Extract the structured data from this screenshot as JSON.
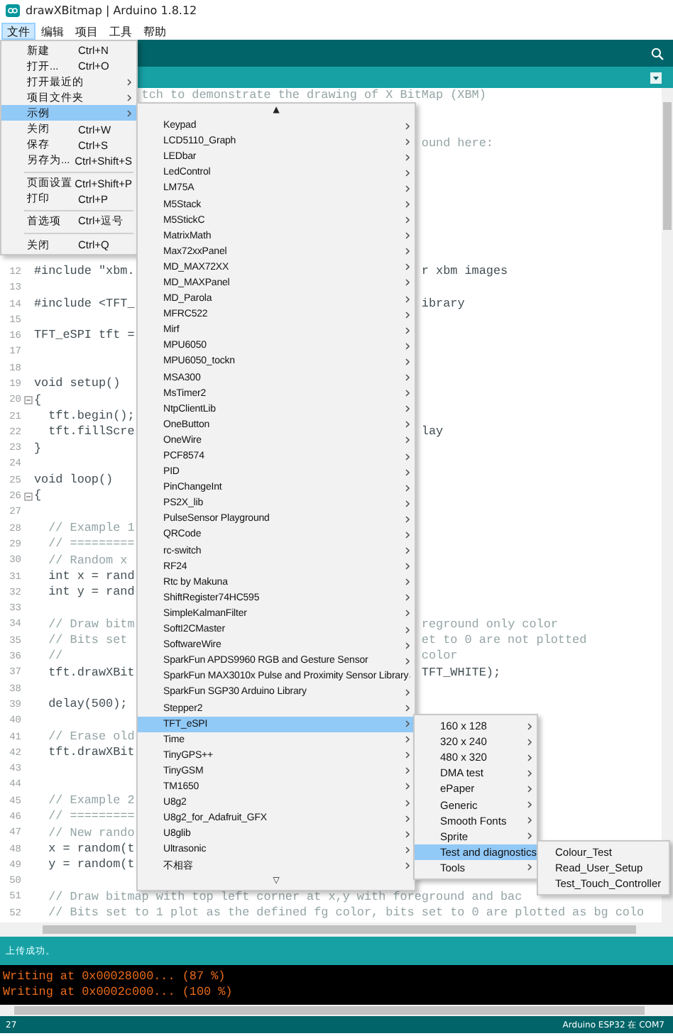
{
  "window": {
    "title": "drawXBitmap | Arduino 1.8.12"
  },
  "menubar": [
    {
      "label": "文件",
      "selected": true
    },
    {
      "label": "编辑",
      "selected": false
    },
    {
      "label": "项目",
      "selected": false
    },
    {
      "label": "工具",
      "selected": false
    },
    {
      "label": "帮助",
      "selected": false
    }
  ],
  "file_menu": [
    {
      "kind": "item",
      "label": "新建",
      "shortcut": "Ctrl+N",
      "submenu": false,
      "selected": false
    },
    {
      "kind": "item",
      "label": "打开...",
      "shortcut": "Ctrl+O",
      "submenu": false,
      "selected": false
    },
    {
      "kind": "item",
      "label": "打开最近的",
      "submenu": true,
      "selected": false
    },
    {
      "kind": "item",
      "label": "项目文件夹",
      "submenu": true,
      "selected": false
    },
    {
      "kind": "item",
      "label": "示例",
      "submenu": true,
      "selected": true
    },
    {
      "kind": "item",
      "label": "关闭",
      "shortcut": "Ctrl+W",
      "submenu": false,
      "selected": false
    },
    {
      "kind": "item",
      "label": "保存",
      "shortcut": "Ctrl+S",
      "submenu": false,
      "selected": false
    },
    {
      "kind": "item",
      "label": "另存为...",
      "shortcut": "Ctrl+Shift+S",
      "submenu": false,
      "selected": false
    },
    {
      "kind": "separator"
    },
    {
      "kind": "item",
      "label": "页面设置",
      "shortcut": "Ctrl+Shift+P",
      "submenu": false,
      "selected": false
    },
    {
      "kind": "item",
      "label": "打印",
      "shortcut": "Ctrl+P",
      "submenu": false,
      "selected": false
    },
    {
      "kind": "separator"
    },
    {
      "kind": "item",
      "label": "首选项",
      "shortcut": "Ctrl+逗号",
      "submenu": false,
      "selected": false
    },
    {
      "kind": "separator"
    },
    {
      "kind": "item",
      "label": "关闭",
      "shortcut": "Ctrl+Q",
      "submenu": false,
      "selected": false
    }
  ],
  "examples_menu": {
    "scroll_up": "▲",
    "scroll_down": "▽",
    "items": [
      {
        "label": "Keypad",
        "selected": false
      },
      {
        "label": "LCD5110_Graph",
        "selected": false
      },
      {
        "label": "LEDbar",
        "selected": false
      },
      {
        "label": "LedControl",
        "selected": false
      },
      {
        "label": "LM75A",
        "selected": false
      },
      {
        "label": "M5Stack",
        "selected": false
      },
      {
        "label": "M5StickC",
        "selected": false
      },
      {
        "label": "MatrixMath",
        "selected": false
      },
      {
        "label": "Max72xxPanel",
        "selected": false
      },
      {
        "label": "MD_MAX72XX",
        "selected": false
      },
      {
        "label": "MD_MAXPanel",
        "selected": false
      },
      {
        "label": "MD_Parola",
        "selected": false
      },
      {
        "label": "MFRC522",
        "selected": false
      },
      {
        "label": "Mirf",
        "selected": false
      },
      {
        "label": "MPU6050",
        "selected": false
      },
      {
        "label": "MPU6050_tockn",
        "selected": false
      },
      {
        "label": "MSA300",
        "selected": false
      },
      {
        "label": "MsTimer2",
        "selected": false
      },
      {
        "label": "NtpClientLib",
        "selected": false
      },
      {
        "label": "OneButton",
        "selected": false
      },
      {
        "label": "OneWire",
        "selected": false
      },
      {
        "label": "PCF8574",
        "selected": false
      },
      {
        "label": "PID",
        "selected": false
      },
      {
        "label": "PinChangeInt",
        "selected": false
      },
      {
        "label": "PS2X_lib",
        "selected": false
      },
      {
        "label": "PulseSensor Playground",
        "selected": false
      },
      {
        "label": "QRCode",
        "selected": false
      },
      {
        "label": "rc-switch",
        "selected": false
      },
      {
        "label": "RF24",
        "selected": false
      },
      {
        "label": "Rtc by Makuna",
        "selected": false
      },
      {
        "label": "ShiftRegister74HC595",
        "selected": false
      },
      {
        "label": "SimpleKalmanFilter",
        "selected": false
      },
      {
        "label": "SoftI2CMaster",
        "selected": false
      },
      {
        "label": "SoftwareWire",
        "selected": false
      },
      {
        "label": "SparkFun APDS9960 RGB and Gesture Sensor",
        "selected": false
      },
      {
        "label": "SparkFun MAX3010x Pulse and Proximity Sensor Library",
        "selected": false
      },
      {
        "label": "SparkFun SGP30 Arduino Library",
        "selected": false
      },
      {
        "label": "Stepper2",
        "selected": false
      },
      {
        "label": "TFT_eSPI",
        "selected": true
      },
      {
        "label": "Time",
        "selected": false
      },
      {
        "label": "TinyGPS++",
        "selected": false
      },
      {
        "label": "TinyGSM",
        "selected": false
      },
      {
        "label": "TM1650",
        "selected": false
      },
      {
        "label": "U8g2",
        "selected": false
      },
      {
        "label": "U8g2_for_Adafruit_GFX",
        "selected": false
      },
      {
        "label": "U8glib",
        "selected": false
      },
      {
        "label": "Ultrasonic",
        "selected": false
      },
      {
        "label": "不相容",
        "selected": false
      }
    ]
  },
  "tft_menu": [
    {
      "label": "160 x 128",
      "selected": false
    },
    {
      "label": "320 x 240",
      "selected": false
    },
    {
      "label": "480 x 320",
      "selected": false
    },
    {
      "label": "DMA test",
      "selected": false
    },
    {
      "label": "ePaper",
      "selected": false
    },
    {
      "label": "Generic",
      "selected": false
    },
    {
      "label": "Smooth Fonts",
      "selected": false
    },
    {
      "label": "Sprite",
      "selected": false
    },
    {
      "label": "Test and diagnostics",
      "selected": true
    },
    {
      "label": "Tools",
      "selected": false
    }
  ],
  "diagnostics_menu": [
    {
      "label": "Colour_Test",
      "selected": false
    },
    {
      "label": "Read_User_Setup",
      "selected": false
    },
    {
      "label": "Test_Touch_Controller",
      "selected": false
    }
  ],
  "editor": {
    "lines": [
      {
        "kind": "comment",
        "fold": false,
        "right": "tch to demonstrate the drawing of X BitMap (XBM)"
      },
      {
        "fold": false
      },
      {
        "fold": false
      },
      {
        "kind": "comment",
        "fold": false,
        "right": "ound here:"
      },
      {
        "fold": false
      },
      {
        "fold": false
      },
      {
        "fold": false
      },
      {
        "fold": false
      },
      {
        "fold": false
      },
      {
        "fold": false
      },
      {
        "fold": false
      },
      {
        "kind": "code",
        "fold": false,
        "number": "12",
        "left": "#include \"xbm.",
        "right": "r xbm images"
      },
      {
        "fold": false,
        "number": "13"
      },
      {
        "kind": "code",
        "fold": false,
        "number": "14",
        "left": "#include <TFT_",
        "right": "ibrary"
      },
      {
        "fold": false,
        "number": "15"
      },
      {
        "kind": "code",
        "fold": false,
        "number": "16",
        "left": "TFT_eSPI tft ="
      },
      {
        "fold": false,
        "number": "17"
      },
      {
        "fold": false,
        "number": "18"
      },
      {
        "kind": "code",
        "fold": false,
        "number": "19",
        "left": "void setup()"
      },
      {
        "kind": "code",
        "fold": true,
        "number": "20",
        "left": "{"
      },
      {
        "kind": "code",
        "fold": false,
        "number": "21",
        "left": "  tft.begin();"
      },
      {
        "kind": "code",
        "fold": false,
        "number": "22",
        "left": "  tft.fillScre",
        "right": "lay"
      },
      {
        "kind": "code",
        "fold": false,
        "number": "23",
        "left": "}"
      },
      {
        "fold": false,
        "number": "24"
      },
      {
        "kind": "code",
        "fold": false,
        "number": "25",
        "left": "void loop()"
      },
      {
        "kind": "code",
        "fold": true,
        "number": "26",
        "left": "{"
      },
      {
        "fold": false,
        "number": "27"
      },
      {
        "kind": "comment",
        "fold": false,
        "number": "28",
        "left": "  // Example 1"
      },
      {
        "kind": "comment",
        "fold": false,
        "number": "29",
        "left": "  // ========="
      },
      {
        "kind": "comment",
        "fold": false,
        "number": "30",
        "left": "  // Random x"
      },
      {
        "kind": "code",
        "fold": false,
        "number": "31",
        "left": "  int x = rand"
      },
      {
        "kind": "code",
        "fold": false,
        "number": "32",
        "left": "  int y = rand"
      },
      {
        "fold": false,
        "number": "33"
      },
      {
        "kind": "comment",
        "fold": false,
        "number": "34",
        "left": "  // Draw bitm",
        "right": "reground only color"
      },
      {
        "kind": "comment",
        "fold": false,
        "number": "35",
        "left": "  // Bits set",
        "right": "et to 0 are not plotted"
      },
      {
        "kind": "comment",
        "fold": false,
        "number": "36",
        "left": "  //",
        "right": "color"
      },
      {
        "kind": "code",
        "fold": false,
        "number": "37",
        "left": "  tft.drawXBit",
        "right": "TFT_WHITE);"
      },
      {
        "fold": false,
        "number": "38"
      },
      {
        "kind": "code",
        "fold": false,
        "number": "39",
        "left": "  delay(500);"
      },
      {
        "fold": false,
        "number": "40"
      },
      {
        "kind": "comment",
        "fold": false,
        "number": "41",
        "left": "  // Erase old"
      },
      {
        "kind": "code",
        "fold": false,
        "number": "42",
        "left": "  tft.drawXBit"
      },
      {
        "fold": false,
        "number": "43"
      },
      {
        "fold": false,
        "number": "44"
      },
      {
        "kind": "comment",
        "fold": false,
        "number": "45",
        "left": "  // Example 2"
      },
      {
        "kind": "comment",
        "fold": false,
        "number": "46",
        "left": "  // ========="
      },
      {
        "kind": "comment",
        "fold": false,
        "number": "47",
        "left": "  // New rando"
      },
      {
        "kind": "code",
        "fold": false,
        "number": "48",
        "left": "  x = random(t"
      },
      {
        "kind": "code",
        "fold": false,
        "number": "49",
        "left": "  y = random(t"
      },
      {
        "fold": false,
        "number": "50"
      },
      {
        "kind": "comment",
        "fold": false,
        "number": "51",
        "left": "  // Draw bitmap with top left corner at x,y with foreground and bac"
      },
      {
        "kind": "comment",
        "fold": false,
        "number": "52",
        "left": "  // Bits set to 1 plot as the defined fg color, bits set to 0 are plotted as bg colo"
      }
    ]
  },
  "status": "上传成功。",
  "console": [
    "Writing at 0x00028000... (87 %)",
    "Writing at 0x0002c000... (100 %)"
  ],
  "footer": {
    "line": "27",
    "board": "Arduino ESP32 在 COM7"
  }
}
